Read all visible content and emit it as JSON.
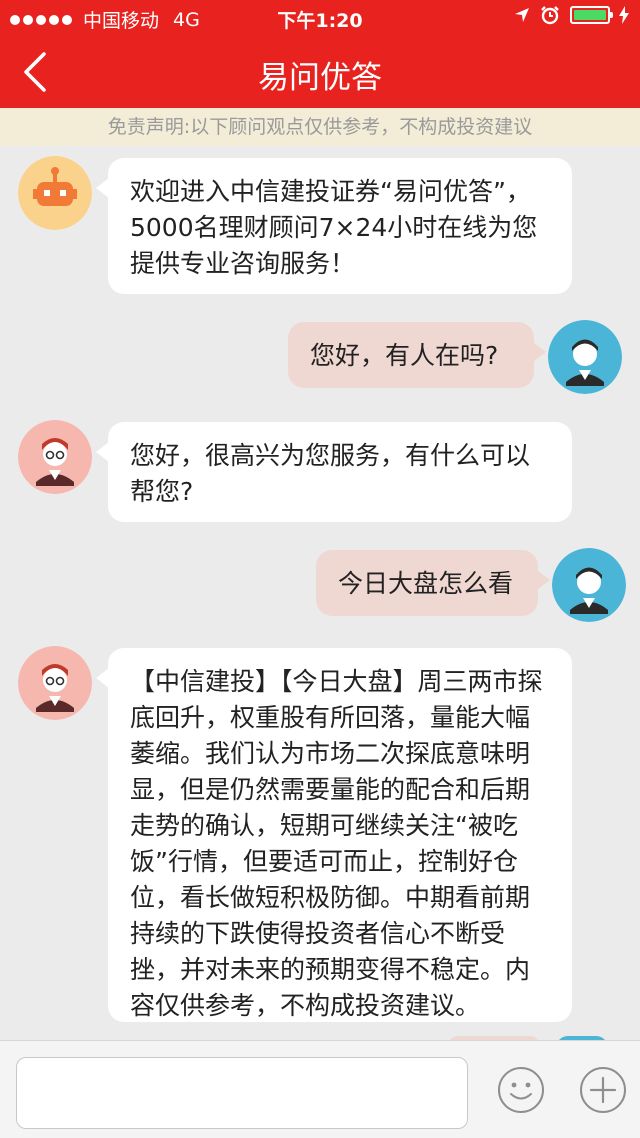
{
  "status_bar": {
    "carrier": "中国移动",
    "network": "4G",
    "time": "下午1:20"
  },
  "nav": {
    "title": "易问优答",
    "back_icon": "chevron-left-icon"
  },
  "disclaimer": "免责声明:以下顾问观点仅供参考，不构成投资建议",
  "messages": [
    {
      "from": "robot",
      "text": "欢迎进入中信建投证券“易问优答”，5000名理财顾问7×24小时在线为您提供专业咨询服务！"
    },
    {
      "from": "user",
      "text": "您好，有人在吗?"
    },
    {
      "from": "advisor",
      "text": "您好，很高兴为您服务，有什么可以帮您?"
    },
    {
      "from": "user",
      "text": "今日大盘怎么看"
    },
    {
      "from": "advisor",
      "text": "【中信建投】【今日大盘】周三两市探底回升，权重股有所回落，量能大幅萎缩。我们认为市场二次探底意味明显，但是仍然需要量能的配合和后期走势的确认，短期可继续关注“被吃饭”行情，但要适可而止，控制好仓位，看长做短积极防御。中期看前期持续的下跌使得投资者信心不断受挫，并对未来的预期变得不稳定。内容仅供参考，不构成投资建议。"
    }
  ],
  "input_bar": {
    "placeholder": "",
    "emoji_icon": "smiley-icon",
    "plus_icon": "plus-circle-icon"
  },
  "colors": {
    "brand_red": "#e8231f",
    "user_bubble": "#f0d8d2",
    "user_avatar": "#4ab5d7",
    "advisor_avatar": "#f6b7ae",
    "robot_avatar": "#fbd28b"
  }
}
